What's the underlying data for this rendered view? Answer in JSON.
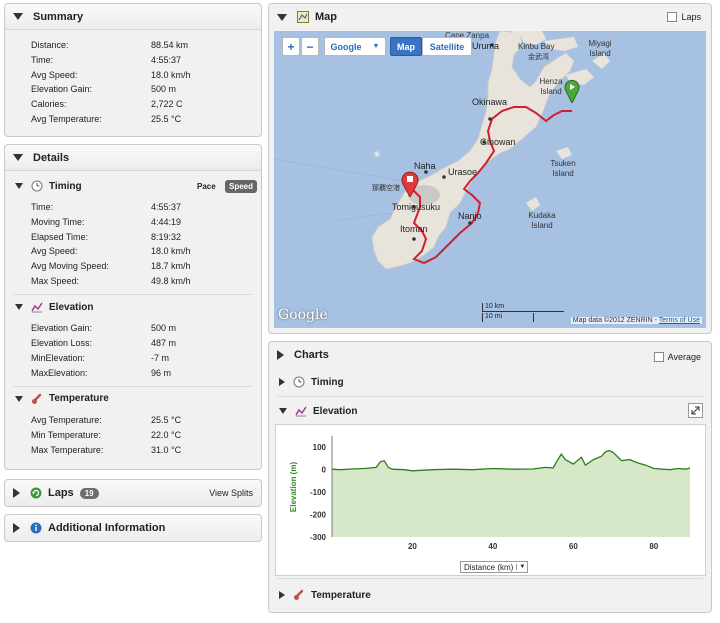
{
  "summary": {
    "title": "Summary",
    "rows": [
      {
        "label": "Distance:",
        "value": "88.54 km"
      },
      {
        "label": "Time:",
        "value": "4:55:37"
      },
      {
        "label": "Avg Speed:",
        "value": "18.0 km/h"
      },
      {
        "label": "Elevation Gain:",
        "value": "500 m"
      },
      {
        "label": "Calories:",
        "value": "2,722 C"
      },
      {
        "label": "Avg Temperature:",
        "value": "25.5 °C"
      }
    ]
  },
  "details": {
    "title": "Details",
    "timing": {
      "title": "Timing",
      "pace_label": "Pace",
      "speed_label": "Speed",
      "rows": [
        {
          "label": "Time:",
          "value": "4:55:37"
        },
        {
          "label": "Moving Time:",
          "value": "4:44:19"
        },
        {
          "label": "Elapsed Time:",
          "value": "8:19:32"
        },
        {
          "label": "Avg Speed:",
          "value": "18.0 km/h"
        },
        {
          "label": "Avg Moving Speed:",
          "value": "18.7 km/h"
        },
        {
          "label": "Max Speed:",
          "value": "49.8 km/h"
        }
      ]
    },
    "elevation": {
      "title": "Elevation",
      "rows": [
        {
          "label": "Elevation Gain:",
          "value": "500 m"
        },
        {
          "label": "Elevation Loss:",
          "value": "487 m"
        },
        {
          "label": "MinElevation:",
          "value": "-7 m"
        },
        {
          "label": "MaxElevation:",
          "value": "96 m"
        }
      ]
    },
    "temperature": {
      "title": "Temperature",
      "rows": [
        {
          "label": "Avg Temperature:",
          "value": "25.5 °C"
        },
        {
          "label": "Min Temperature:",
          "value": "22.0 °C"
        },
        {
          "label": "Max Temperature:",
          "value": "31.0 °C"
        }
      ]
    }
  },
  "laps": {
    "title": "Laps",
    "count": "19",
    "view_splits": "View Splits"
  },
  "additional": {
    "title": "Additional Information"
  },
  "map": {
    "title": "Map",
    "laps_label": "Laps",
    "zoom_in": "+",
    "zoom_out": "−",
    "provider": "Google",
    "map_type_map": "Map",
    "map_type_satellite": "Satellite",
    "places": {
      "cape_zanpa": "Cape Zanpa",
      "uruma": "Uruma",
      "kinbu_bay": "Kinbu Bay",
      "kinbu_bay_jp": "金武湾",
      "miyagi_island": "Miyagi Island",
      "henza_island": "Henza Island",
      "okinawa": "Okinawa",
      "ginowan": "Ginowan",
      "naha": "Naha",
      "urasoe": "Urasoe",
      "naha_airport": "那覇空港",
      "tomigusuku": "Tomigusuku",
      "tsuken_island": "Tsuken Island",
      "nanjo": "Nanjo",
      "kudaka_island": "Kudaka Island",
      "itoman": "Itoman"
    },
    "google_logo": "Google",
    "scale_km": "10 km",
    "scale_mi": "10 mi",
    "attribution": "Map data ©2012 ZENRIN",
    "terms": "Terms of Use"
  },
  "charts": {
    "title": "Charts",
    "average_label": "Average",
    "timing_title": "Timing",
    "elevation_title": "Elevation",
    "temperature_title": "Temperature",
    "axis_selector": "Distance (km)"
  },
  "chart_data": {
    "type": "area",
    "title": "",
    "xlabel": "Distance (km)",
    "ylabel": "Elevation (m)",
    "xlim": [
      0,
      90
    ],
    "ylim": [
      -300,
      150
    ],
    "xticks": [
      20,
      40,
      60,
      80
    ],
    "yticks": [
      100,
      0,
      -100,
      -200,
      -300
    ],
    "grid": false,
    "series": [
      {
        "x": [
          0,
          2,
          5,
          8,
          11,
          12,
          13,
          14,
          15,
          18,
          20,
          25,
          30,
          35,
          40,
          45,
          50,
          53,
          55,
          56,
          57,
          58,
          60,
          62,
          63,
          65,
          67,
          68,
          69,
          70,
          72,
          74,
          76,
          78,
          80,
          84,
          86,
          88,
          89
        ],
        "values": [
          2,
          0,
          3,
          5,
          10,
          35,
          40,
          10,
          2,
          0,
          -5,
          0,
          2,
          0,
          5,
          2,
          3,
          10,
          8,
          40,
          70,
          45,
          25,
          55,
          20,
          45,
          60,
          80,
          85,
          75,
          40,
          45,
          30,
          20,
          5,
          0,
          5,
          2,
          8
        ]
      }
    ]
  }
}
